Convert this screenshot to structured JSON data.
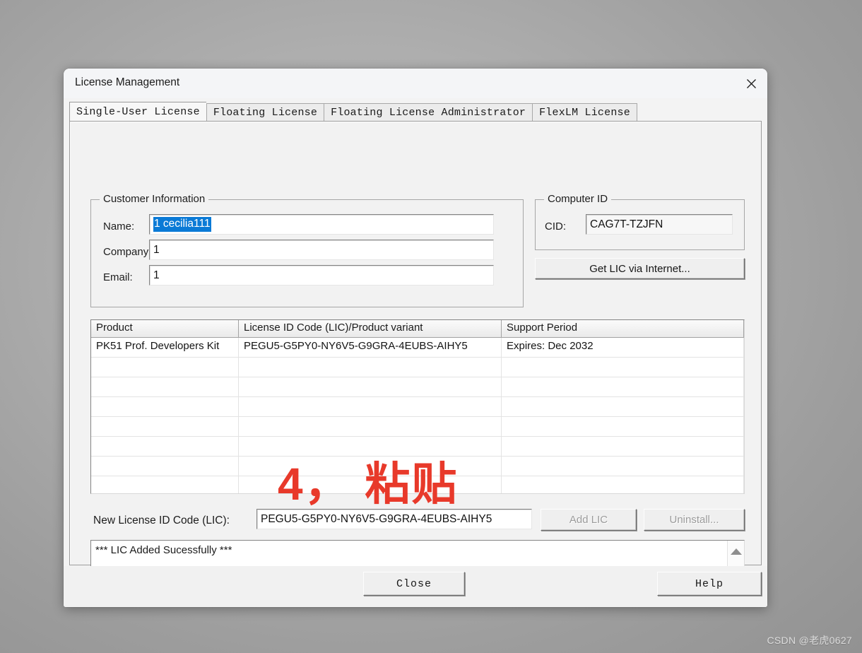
{
  "window": {
    "title": "License Management",
    "close_icon": "close-icon"
  },
  "tabs": [
    {
      "label": "Single-User License",
      "active": true
    },
    {
      "label": "Floating License",
      "active": false
    },
    {
      "label": "Floating License Administrator",
      "active": false
    },
    {
      "label": "FlexLM License",
      "active": false
    }
  ],
  "customer_information": {
    "group_title": "Customer Information",
    "name_label": "Name:",
    "name_value": "1 cecilia111",
    "name_selected": true,
    "company_label": "Company:",
    "company_value": "1",
    "email_label": "Email:",
    "email_value": "1"
  },
  "computer_id": {
    "group_title": "Computer ID",
    "cid_label": "CID:",
    "cid_value": "CAG7T-TZJFN",
    "get_lic_button": "Get LIC via Internet..."
  },
  "license_table": {
    "columns": [
      "Product",
      "License ID Code (LIC)/Product variant",
      "Support Period"
    ],
    "rows": [
      [
        "PK51 Prof. Developers Kit",
        "PEGU5-G5PY0-NY6V5-G9GRA-4EUBS-AIHY5",
        "Expires: Dec 2032"
      ]
    ],
    "empty_row_count": 7
  },
  "new_license": {
    "label": "New License ID Code (LIC):",
    "value": "PEGU5-G5PY0-NY6V5-G9GRA-4EUBS-AIHY5",
    "add_button": "Add LIC",
    "add_button_enabled": false,
    "uninstall_button": "Uninstall...",
    "uninstall_button_enabled": false
  },
  "status": {
    "message": "*** LIC Added Sucessfully ***",
    "scroll_up_icon": "triangle-up-icon",
    "scroll_down_icon": "triangle-down-icon"
  },
  "footer": {
    "close_button": "Close",
    "help_button": "Help"
  },
  "annotation": {
    "text": "4， 粘贴",
    "color": "#e8392a"
  },
  "desktop": {
    "watermark": "CSDN @老虎0627"
  }
}
